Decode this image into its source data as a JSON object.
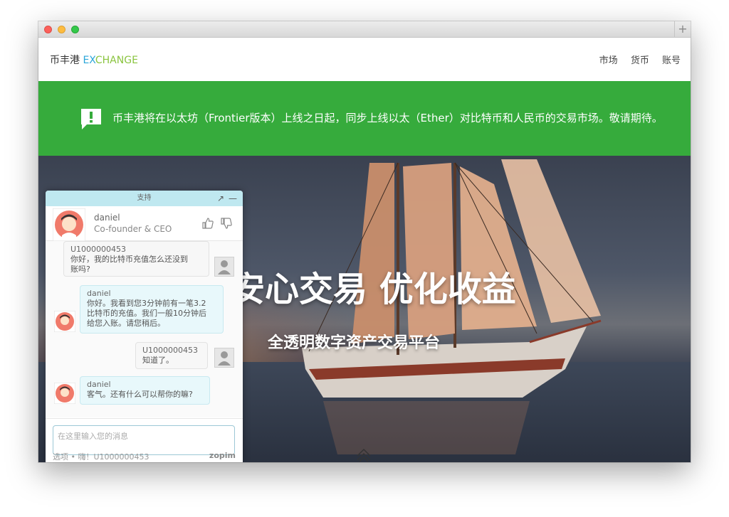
{
  "navbar": {
    "logo": {
      "prefix": "币丰港 ",
      "ex_blue": "EX",
      "ex_green": "CHANGE"
    },
    "links": [
      "市场",
      "货币",
      "账号"
    ]
  },
  "banner": {
    "icon": "exclamation-speech-icon",
    "text": "币丰港将在以太坊（Frontier版本）上线之日起，同步上线以太（Ether）对比特币和人民币的交易市场。敬请期待。"
  },
  "hero": {
    "title": "安心交易 优化收益",
    "subtitle": "全透明数字资产交易平台"
  },
  "chat": {
    "header_title": "支持",
    "agent_name": "daniel",
    "agent_role": "Co-founder & CEO",
    "messages": [
      {
        "sender": "U1000000453",
        "text": "你好，我的比特币充值怎么还没到账吗?",
        "line1": "你好，我的比特币充值怎么还没到",
        "line2": "账吗?"
      },
      {
        "sender": "daniel",
        "line1": "你好。我看到您3分钟前有一笔3.2",
        "line2": "比特币的充值。我们一般10分钟后",
        "line3": "给您入账。请您稍后。"
      },
      {
        "sender": "U1000000453",
        "line1": "知道了。"
      },
      {
        "sender": "daniel",
        "line1": "客气。还有什么可以帮你的嘛?"
      }
    ],
    "input_placeholder": "在这里输入您的消息",
    "footer_left": "选项 • 嗨！U1000000453",
    "footer_brand": "zopim"
  },
  "colors": {
    "banner": "#36ab3c",
    "chat_header": "#bfe8f0"
  }
}
